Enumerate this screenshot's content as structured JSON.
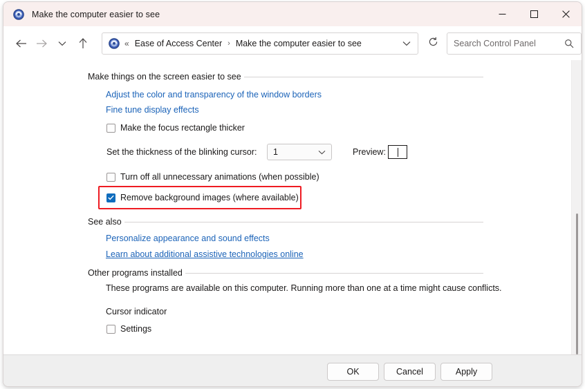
{
  "window": {
    "title": "Make the computer easier to see",
    "app_icon": "ease-of-access-icon",
    "controls": {
      "minimize": "minimize-icon",
      "maximize": "maximize-icon",
      "close": "close-icon"
    }
  },
  "nav": {
    "back": "back-arrow-icon",
    "forward": "forward-arrow-icon",
    "recent": "chevron-down-icon",
    "up": "up-arrow-icon",
    "breadcrumb": {
      "icon": "ease-of-access-icon",
      "overflow": "«",
      "items": [
        "Ease of Access Center",
        "Make the computer easier to see"
      ],
      "separator": "›",
      "dropdown": "chevron-down-icon"
    },
    "refresh": "refresh-icon",
    "search": {
      "placeholder": "Search Control Panel",
      "icon": "search-icon",
      "value": ""
    }
  },
  "main": {
    "section1": {
      "heading": "Make things on the screen easier to see",
      "links": [
        "Adjust the color and transparency of the window borders",
        "Fine tune display effects"
      ],
      "checkbox_focus_rect": {
        "label": "Make the focus rectangle thicker",
        "checked": false
      },
      "cursor_thickness": {
        "label": "Set the thickness of the blinking cursor:",
        "value": "1",
        "preview_label": "Preview:"
      },
      "checkbox_animations": {
        "label": "Turn off all unnecessary animations (when possible)",
        "checked": false
      },
      "checkbox_background_images": {
        "label": "Remove background images (where available)",
        "checked": true,
        "highlighted": true,
        "highlight_color": "#ee1b22"
      }
    },
    "section2": {
      "heading": "See also",
      "links": [
        "Personalize appearance and sound effects",
        "Learn about additional assistive technologies online"
      ]
    },
    "section3": {
      "heading": "Other programs installed",
      "description": "These programs are available on this computer. Running more than one at a time might cause conflicts.",
      "program_name": "Cursor indicator",
      "checkbox_settings": {
        "label": "Settings",
        "checked": false
      }
    }
  },
  "footer": {
    "ok": "OK",
    "cancel": "Cancel",
    "apply": "Apply"
  },
  "colors": {
    "titlebar": "#f9efee",
    "link": "#1b63b8",
    "checkbox_checked": "#0f6cbd",
    "highlight": "#ee1b22",
    "footer": "#efefef"
  }
}
